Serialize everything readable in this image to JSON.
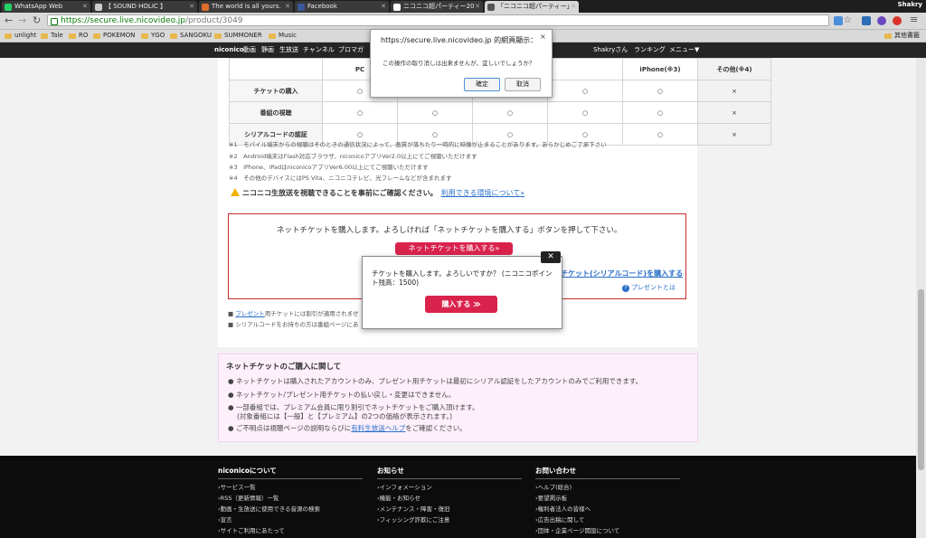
{
  "browser": {
    "tabs": [
      {
        "label": "WhatsApp Web",
        "icon": "whatsapp-icon",
        "color": "#25d366"
      },
      {
        "label": "【 SOUND HOLIC 】",
        "icon": "page-icon",
        "color": "#cccccc"
      },
      {
        "label": "The world is all yours.",
        "icon": "blog-icon",
        "color": "#e06d2c"
      },
      {
        "label": "Facebook",
        "icon": "facebook-icon",
        "color": "#3b5998"
      },
      {
        "label": "ニコニコ超パーティー20",
        "icon": "page-icon",
        "color": "#ffffff"
      },
      {
        "label": "「ニコニコ超パーティー」",
        "icon": "niconico-icon",
        "color": "#ffffff"
      }
    ],
    "user": "Shakry",
    "url_host": "https://secure.live.nicovideo.jp",
    "url_path": "/product/3049",
    "bookmarks": [
      "unlight",
      "Tale",
      "RO",
      "POKEMON",
      "YGO",
      "SANGOKU",
      "SUMMONER",
      "Music"
    ],
    "other_bookmarks": "其他書籤"
  },
  "nav": {
    "items": [
      "niconico",
      "動画",
      "静画",
      "生放送",
      "チャンネル",
      "ブロマガ"
    ],
    "user": "Shakryさん",
    "ranking": "ランキング",
    "menu": "メニュー▼"
  },
  "table": {
    "headers": [
      "",
      "PC",
      "",
      "",
      "",
      "iPhone(※3)",
      "その他(※4)"
    ],
    "rows": [
      {
        "label": "チケットの購入",
        "cells": [
          "○",
          "○",
          "○",
          "○",
          "○",
          "×"
        ]
      },
      {
        "label": "番組の視聴",
        "cells": [
          "○",
          "○",
          "○",
          "○",
          "○",
          "×"
        ]
      },
      {
        "label": "シリアルコードの認証",
        "cells": [
          "○",
          "○",
          "○",
          "○",
          "○",
          "×"
        ]
      }
    ]
  },
  "notes": [
    "※1　モバイル端末からの視聴はそのときの通信状況によって、画質が落ちたり一時的に映像が止まることがあります。あらかじめご了承下さい",
    "※2　Android端末はFlash対応ブラウザ、niconicoアプリVer2.0以上にてご視聴いただけます",
    "※3　iPhone、iPadはniconicoアプリVer6.00以上にてご視聴いただけます",
    "※4　その他のデバイスにはPS Vita、ニコニコテレビ、光フレームなどが含まれます"
  ],
  "warning": {
    "text": "ニコニコ生放送を視聴できることを事前にご確認ください。",
    "link": "利用できる環境について»"
  },
  "ticket": {
    "message": "ネットチケットを購入します。よろしければ「ネットチケットを購入する」ボタンを押して下さい。",
    "buy_button": "ネットチケットを購入する»",
    "serial_link": "チケット(シリアルコード)を購入する",
    "present_help": "プレゼントとは"
  },
  "bottom_notes": [
    {
      "link": "プレゼント",
      "text": "用チケットには割引が適用されませ"
    },
    {
      "link": "",
      "text": "シリアルコードをお持ちの方は番組ページにあ"
    }
  ],
  "pink": {
    "title": "ネットチケットのご購入に関して",
    "items": [
      "ネットチケットは購入されたアカウントのみ、プレゼント用チケットは最初にシリアル認証をしたアカウントのみでご利用できます。",
      "ネットチケット/プレゼント用チケットの払い戻し・変更はできません。",
      "一部番組では、プレミアム会員に限り割引でネットチケットをご購入頂けます。",
      "(対象番組には【一般】と【プレミアム】の2つの価格が表示されます。)"
    ],
    "last_prefix": "ご不明点は視聴ページの説明ならびに",
    "last_link": "有料生放送ヘルプ",
    "last_suffix": "をご確認ください。"
  },
  "footer": {
    "columns": [
      {
        "title": "niconicoについて",
        "links": [
          "サービス一覧",
          "RSS（更新情報）一覧",
          "動画・生放送に使用できる音源の検索",
          "宣言",
          "サイトご利用にあたって"
        ]
      },
      {
        "title": "お知らせ",
        "links": [
          "インフォメーション",
          "機能・お知らせ",
          "メンテナンス・障害・復旧",
          "フィッシング詐欺にご注意"
        ]
      },
      {
        "title": "お問い合わせ",
        "links": [
          "ヘルプ(総合)",
          "要望掲示板",
          "権利者法人の皆様へ",
          "広告出稿に関して",
          "団体・企業ページ開設について"
        ]
      }
    ]
  },
  "dialog_confirm": {
    "title": "https://secure.live.nicovideo.jp 的網頁顯示：",
    "message": "この操作の取り消しは出来ませんが、宜しいでしょうか？",
    "ok": "確定",
    "cancel": "取消"
  },
  "dialog_purchase": {
    "message": "チケットを購入します。よろしいですか？ (ニコニコポイント残高：1500)",
    "button": "購入する ≫",
    "close": "✕"
  }
}
